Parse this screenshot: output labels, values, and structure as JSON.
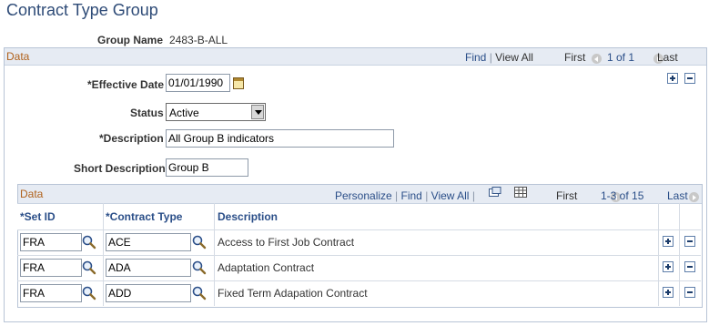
{
  "page": {
    "title": "Contract Type Group"
  },
  "group": {
    "label": "Group Name",
    "value": "2483-B-ALL"
  },
  "outer": {
    "section_title": "Data",
    "nav": {
      "find": "Find",
      "view_all": "View All",
      "first": "First",
      "range": "1 of 1",
      "last": "Last"
    }
  },
  "form": {
    "effective_date": {
      "label": "*Effective Date",
      "value": "01/01/1990"
    },
    "status": {
      "label": "Status",
      "value": "Active"
    },
    "description": {
      "label": "*Description",
      "value": "All Group B indicators"
    },
    "short_description": {
      "label": "Short Description",
      "value": "Group B"
    }
  },
  "grid": {
    "section_title": "Data",
    "nav": {
      "personalize": "Personalize",
      "find": "Find",
      "view_all": "View All",
      "first": "First",
      "range": "1-3 of 15",
      "last": "Last"
    },
    "columns": {
      "setid": "*Set ID",
      "contract_type": "*Contract Type",
      "description": "Description"
    },
    "rows": [
      {
        "setid": "FRA",
        "contract_type": "ACE",
        "description": "Access to First Job Contract"
      },
      {
        "setid": "FRA",
        "contract_type": "ADA",
        "description": "Adaptation Contract"
      },
      {
        "setid": "FRA",
        "contract_type": "ADD",
        "description": "Fixed Term Adapation Contract"
      }
    ]
  },
  "colors": {
    "title": "#2e4b77",
    "link": "#2a4e88",
    "section": "#b0611b",
    "header_bg": "#e6ebf3"
  },
  "icons": [
    "calendar-icon",
    "lookup-icon",
    "add-row-icon",
    "delete-row-icon",
    "previous-icon",
    "next-icon",
    "zoom-icon",
    "download-icon"
  ]
}
